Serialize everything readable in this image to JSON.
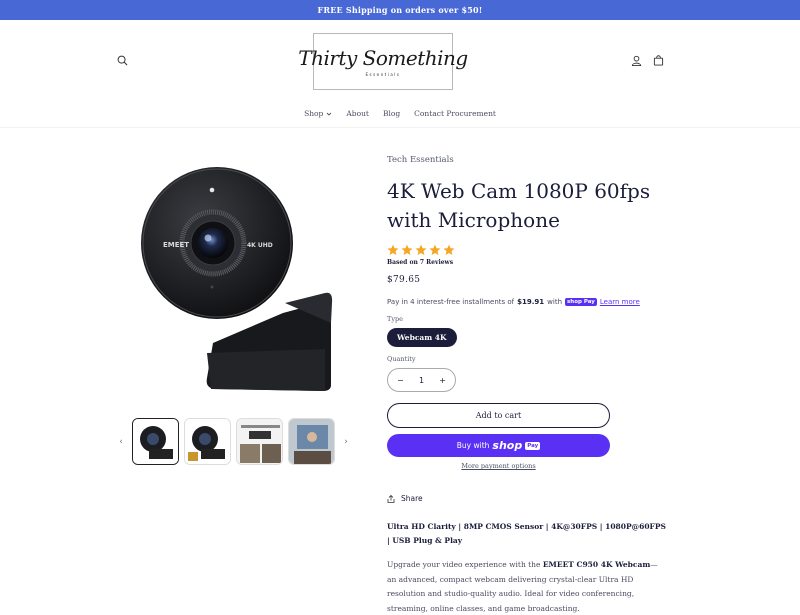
{
  "announcement": "FREE Shipping on orders over $50!",
  "logo": {
    "main": "Thirty Something",
    "sub": "Essentials"
  },
  "nav": [
    {
      "label": "Shop",
      "dropdown": true
    },
    {
      "label": "About"
    },
    {
      "label": "Blog"
    },
    {
      "label": "Contact Procurement"
    }
  ],
  "product": {
    "vendor": "Tech Essentials",
    "title": "4K Web Cam 1080P 60fps with Microphone",
    "rating": 5,
    "reviews_label": "Based on 7 Reviews",
    "price": "$79.65",
    "installments": {
      "prefix": "Pay in 4 interest-free installments of",
      "amount": "$19.91",
      "with": "with",
      "shop_pay": "shop Pay",
      "learn_more": "Learn more"
    },
    "type_label": "Type",
    "variant": "Webcam 4K",
    "quantity_label": "Quantity",
    "quantity": "1",
    "add_to_cart": "Add to cart",
    "buy_with": "Buy with",
    "buy_shop": "shop",
    "buy_pay": "Pay",
    "more_payment": "More payment options",
    "share": "Share",
    "features": "Ultra HD Clarity | 8MP CMOS Sensor | 4K@30FPS | 1080P@60FPS | USB Plug & Play",
    "desc_prefix": "Upgrade your video experience with the",
    "desc_bold": "EMEET C950 4K Webcam",
    "desc_rest": "—an advanced, compact webcam delivering crystal-clear Ultra HD resolution and studio-quality audio. Ideal for video conferencing, streaming, online classes, and game broadcasting."
  },
  "camera": {
    "brand": "EMEET",
    "badge": "4K UHD"
  },
  "colors": {
    "accent": "#4868d6",
    "shop_pay": "#5a31f4",
    "text": "#1b1d3a",
    "star": "#f5a623"
  },
  "icons": [
    "search-icon",
    "user-icon",
    "cart-icon",
    "chevron-down-icon",
    "chevron-left-icon",
    "chevron-right-icon",
    "star-icon",
    "share-icon",
    "minus-icon",
    "plus-icon"
  ]
}
